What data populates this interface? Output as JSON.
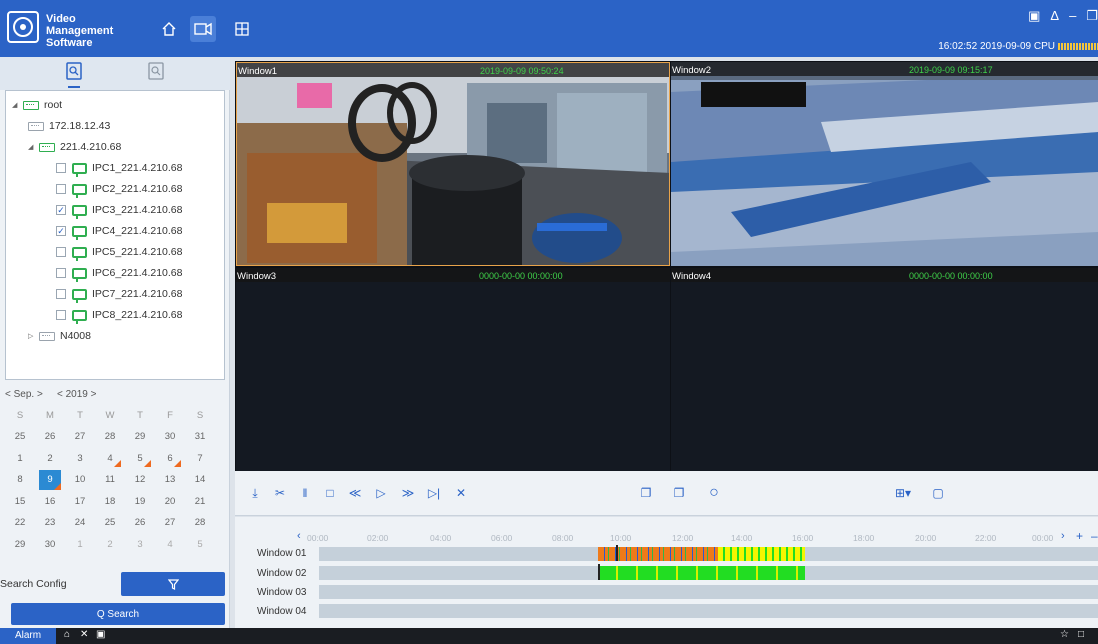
{
  "app": {
    "title_line1": "Video Management",
    "title_line2": "Software"
  },
  "status": {
    "clock": "16:02:52 2019-09-09 CPU"
  },
  "tree": {
    "root": "root",
    "items": [
      {
        "label": "172.18.12.43"
      },
      {
        "label": "221.4.210.68"
      }
    ],
    "cameras": [
      {
        "label": "IPC1_221.4.210.68",
        "checked": false
      },
      {
        "label": "IPC2_221.4.210.68",
        "checked": false
      },
      {
        "label": "IPC3_221.4.210.68",
        "checked": true
      },
      {
        "label": "IPC4_221.4.210.68",
        "checked": true
      },
      {
        "label": "IPC5_221.4.210.68",
        "checked": false
      },
      {
        "label": "IPC6_221.4.210.68",
        "checked": false
      },
      {
        "label": "IPC7_221.4.210.68",
        "checked": false
      },
      {
        "label": "IPC8_221.4.210.68",
        "checked": false
      }
    ],
    "nvr": "N4008"
  },
  "calendar": {
    "month_nav": "< Sep. >",
    "year_nav": "< 2019 >",
    "weekdays": [
      "S",
      "M",
      "T",
      "W",
      "T",
      "F",
      "S"
    ],
    "weeks": [
      [
        "25",
        "26",
        "27",
        "28",
        "29",
        "30",
        "31"
      ],
      [
        "1",
        "2",
        "3",
        "4",
        "5",
        "6",
        "7"
      ],
      [
        "8",
        "9",
        "10",
        "11",
        "12",
        "13",
        "14"
      ],
      [
        "15",
        "16",
        "17",
        "18",
        "19",
        "20",
        "21"
      ],
      [
        "22",
        "23",
        "24",
        "25",
        "26",
        "27",
        "28"
      ],
      [
        "29",
        "30",
        "1",
        "2",
        "3",
        "4",
        "5"
      ]
    ],
    "selected_day": "9"
  },
  "search": {
    "config_label": "Search Config",
    "search_label": "Q  Search"
  },
  "windows": [
    {
      "title": "Window1",
      "time": "2019-09-09 09:50:24"
    },
    {
      "title": "Window2",
      "time": "2019-09-09 09:15:17"
    },
    {
      "title": "Window3",
      "time": "0000-00-00 00:00:00"
    },
    {
      "title": "Window4",
      "time": "0000-00-00 00:00:00"
    }
  ],
  "timeline": {
    "ticks": [
      "00:00",
      "02:00",
      "04:00",
      "06:00",
      "08:00",
      "10:00",
      "12:00",
      "14:00",
      "16:00",
      "18:00",
      "20:00",
      "22:00",
      "00:00"
    ],
    "rows": [
      "Window 01",
      "Window 02",
      "Window 03",
      "Window 04"
    ]
  },
  "bottombar": {
    "alarm": "Alarm"
  },
  "colors": {
    "accent": "#2b63c6",
    "record_orange": "#ee6a20",
    "record_green": "#22dd22",
    "record_yellow": "#f5f500"
  }
}
